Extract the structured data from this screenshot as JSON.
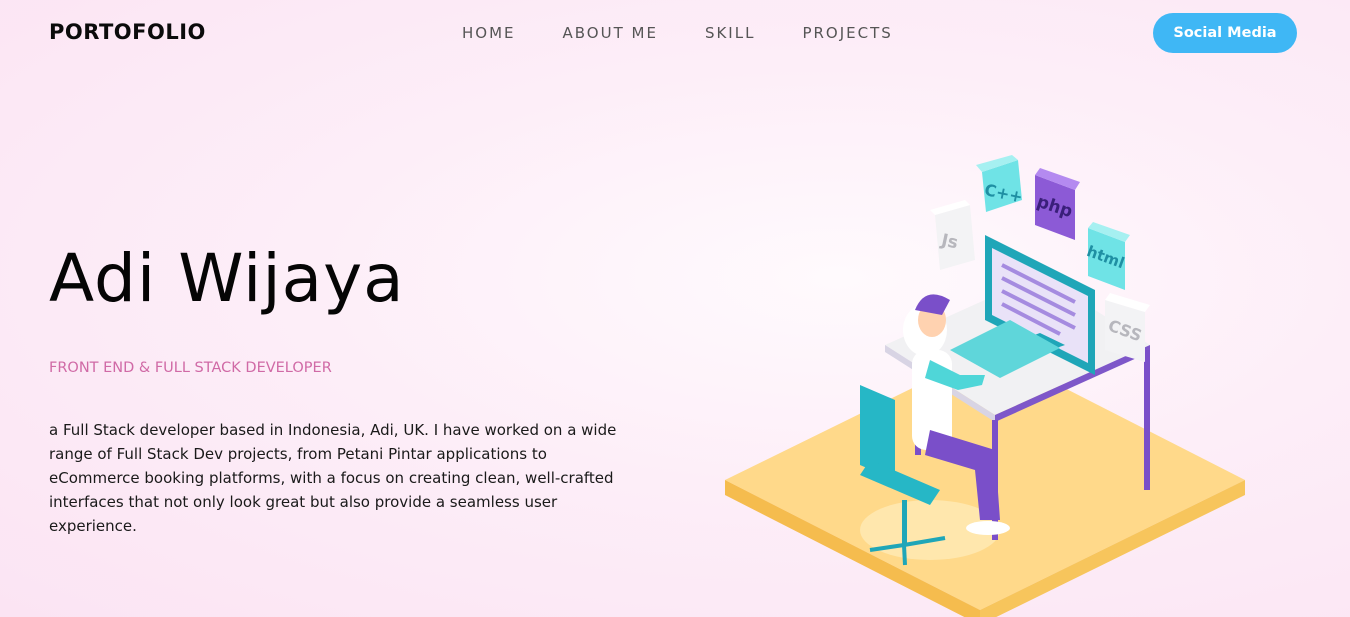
{
  "nav": {
    "brand": "PORTOFOLIO",
    "links": [
      "HOME",
      "ABOUT ME",
      "SKILL",
      "PROJECTS"
    ],
    "cta": "Social Media"
  },
  "hero": {
    "name": "Adi Wijaya",
    "role": "FRONT END & FULL STACK DEVELOPER",
    "bio": "a Full Stack developer based in Indonesia, Adi, UK. I have worked on a wide range of Full Stack Dev projects, from Petani Pintar applications to eCommerce booking platforms, with a focus on creating clean, well-crafted interfaces that not only look great but also provide a seamless user experience."
  },
  "illustration": {
    "cubes": [
      "C++",
      "php",
      "Js",
      "html",
      "CSS"
    ],
    "icon": "developer-at-desk-illustration"
  },
  "colors": {
    "accent": "#3fb7f5",
    "role_text": "#d06aa6",
    "purple": "#7a4fc9",
    "teal": "#3fd3d6",
    "platform": "#ffd98a"
  }
}
